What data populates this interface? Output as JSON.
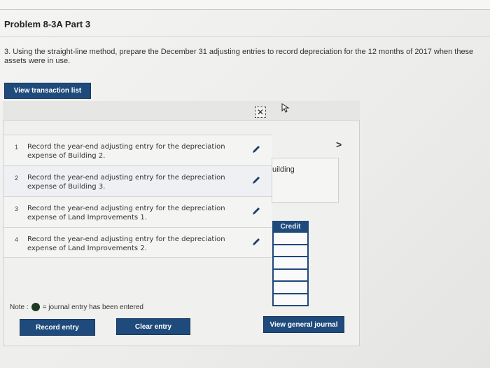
{
  "problem": {
    "title": "Problem 8-3A Part 3",
    "instructions": "3. Using the straight-line method, prepare the December 31 adjusting entries to record depreciation for the 12 months of 2017 when these assets were in use."
  },
  "buttons": {
    "view_transaction_list": "View transaction list",
    "record_entry": "Record entry",
    "clear_entry": "Clear entry",
    "view_general_journal": "View general journal"
  },
  "dialog": {
    "close_glyph": "✕",
    "next_glyph": ">",
    "side_label": "uilding",
    "credit_header": "Credit"
  },
  "entries": [
    {
      "num": "1",
      "text": "Record the year-end adjusting entry for the depreciation expense of Building 2."
    },
    {
      "num": "2",
      "text": "Record the year-end adjusting entry for the depreciation expense of Building 3."
    },
    {
      "num": "3",
      "text": "Record the year-end adjusting entry for the depreciation expense of Land Improvements 1."
    },
    {
      "num": "4",
      "text": "Record the year-end adjusting entry for the depreciation expense of Land Improvements 2."
    }
  ],
  "note": {
    "prefix": "Note :",
    "text": "= journal entry has been entered"
  },
  "colors": {
    "button_blue": "#1f4a7c",
    "entered_dot": "#1c3a24"
  }
}
